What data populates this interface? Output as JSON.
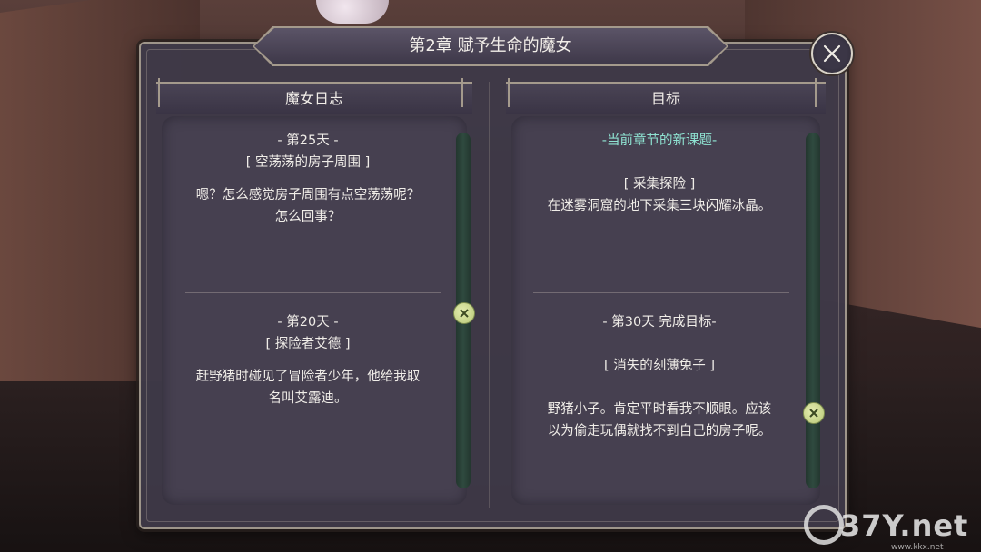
{
  "dialog": {
    "title": "第2章  赋予生命的魔女",
    "close_icon": "close-icon"
  },
  "left_column": {
    "header": "魔女日志",
    "entries": [
      {
        "day": "- 第25天 -",
        "subtitle": "[ 空荡荡的房子周围 ]",
        "text_lines": [
          "嗯？怎么感觉房子周围有点空荡荡呢？",
          "怎么回事？"
        ]
      },
      {
        "day": "- 第20天 -",
        "subtitle": "[ 探险者艾德 ]",
        "text_lines": [
          "赶野猪时碰见了冒险者少年，他给我取",
          "名叫艾露迪。"
        ]
      }
    ]
  },
  "right_column": {
    "header": "目标",
    "current_label": "-当前章节的新课题-",
    "current_goal": {
      "subtitle": "[ 采集探险 ]",
      "text": "在迷雾洞窟的地下采集三块闪耀冰晶。"
    },
    "completed_label": "- 第30天  完成目标-",
    "completed_goal": {
      "subtitle": "[ 消失的刻薄兔子 ]",
      "text_lines": [
        "野猪小子。肯定平时看我不顺眼。应该",
        "以为偷走玩偶就找不到自己的房子呢。"
      ]
    }
  },
  "scrollbars": {
    "knob_icon": "x-knob-icon"
  },
  "watermark": {
    "main": "37Y.net",
    "small": "www.kkx.net"
  },
  "colors": {
    "accent_teal": "#8fe3d2",
    "panel_bg": "#3e3948",
    "knob": "#cbd98a"
  }
}
